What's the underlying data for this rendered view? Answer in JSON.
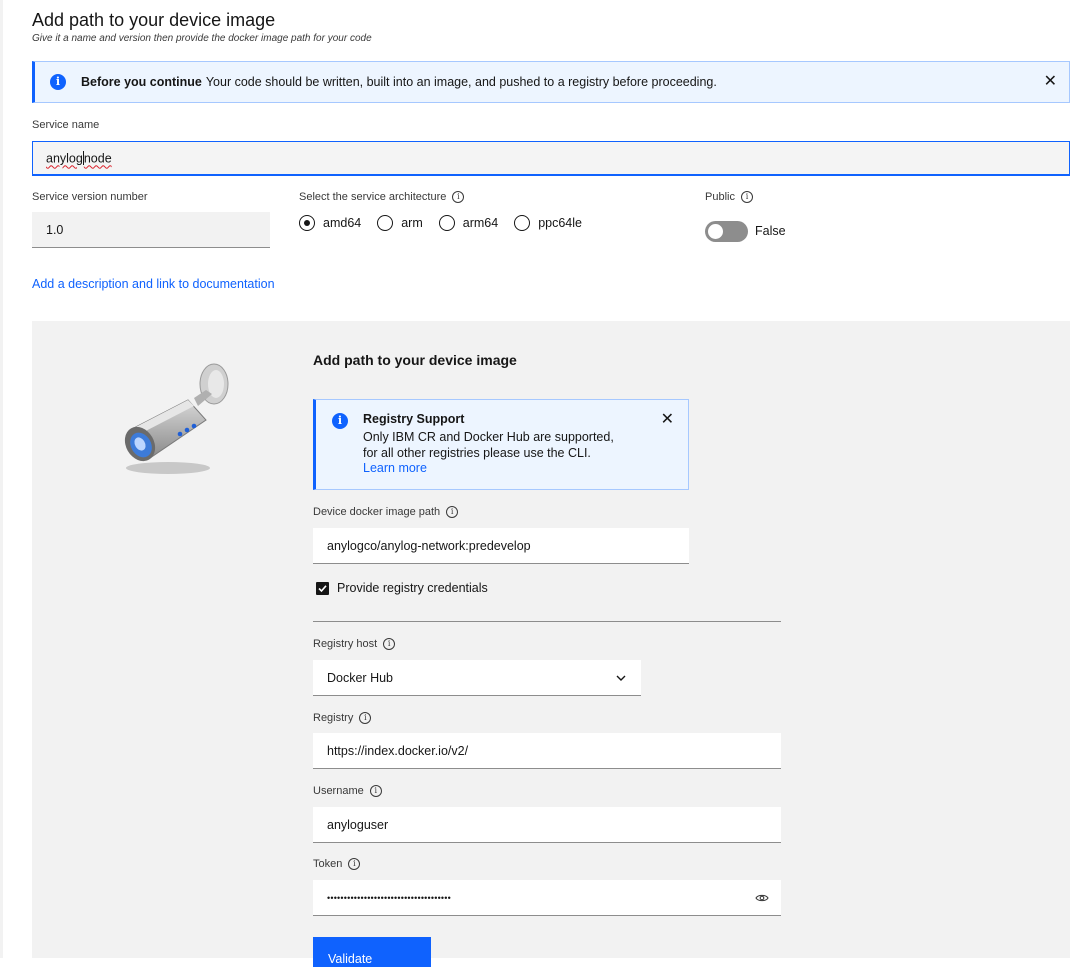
{
  "header": {
    "title": "Add path to your device image",
    "subtitle": "Give it a name and version then provide the docker image path for your code"
  },
  "notification": {
    "title": "Before you continue",
    "message": "Your code should be written, built into an image, and pushed to a registry before proceeding."
  },
  "service_name": {
    "label": "Service name",
    "value_part1": "anylog",
    "value_part2": "node"
  },
  "service_version": {
    "label": "Service version number",
    "value": "1.0"
  },
  "architecture": {
    "label": "Select the service architecture",
    "options": [
      "amd64",
      "arm",
      "arm64",
      "ppc64le"
    ],
    "selected": "amd64"
  },
  "public": {
    "label": "Public",
    "state": "False"
  },
  "description_link": "Add a description and link to documentation",
  "image_section": {
    "title": "Add path to your device image",
    "registry_notice": {
      "title": "Registry Support",
      "line1": "Only IBM CR and Docker Hub are supported,",
      "line2": "for all other registries please use the CLI.",
      "link": "Learn more"
    },
    "docker_path": {
      "label": "Device docker image path",
      "value": "anylogco/anylog-network:predevelop"
    },
    "credentials_checkbox": "Provide registry credentials",
    "registry_host": {
      "label": "Registry host",
      "value": "Docker Hub"
    },
    "registry": {
      "label": "Registry",
      "value": "https://index.docker.io/v2/"
    },
    "username": {
      "label": "Username",
      "value": "anyloguser"
    },
    "token": {
      "label": "Token",
      "value": "•••••••••••••••••••••••••••••••••••••"
    },
    "validate_button": "Validate"
  },
  "colors": {
    "primary": "#0f62fe",
    "notification_bg": "#edf5ff",
    "panel_bg": "#f2f2f2"
  }
}
